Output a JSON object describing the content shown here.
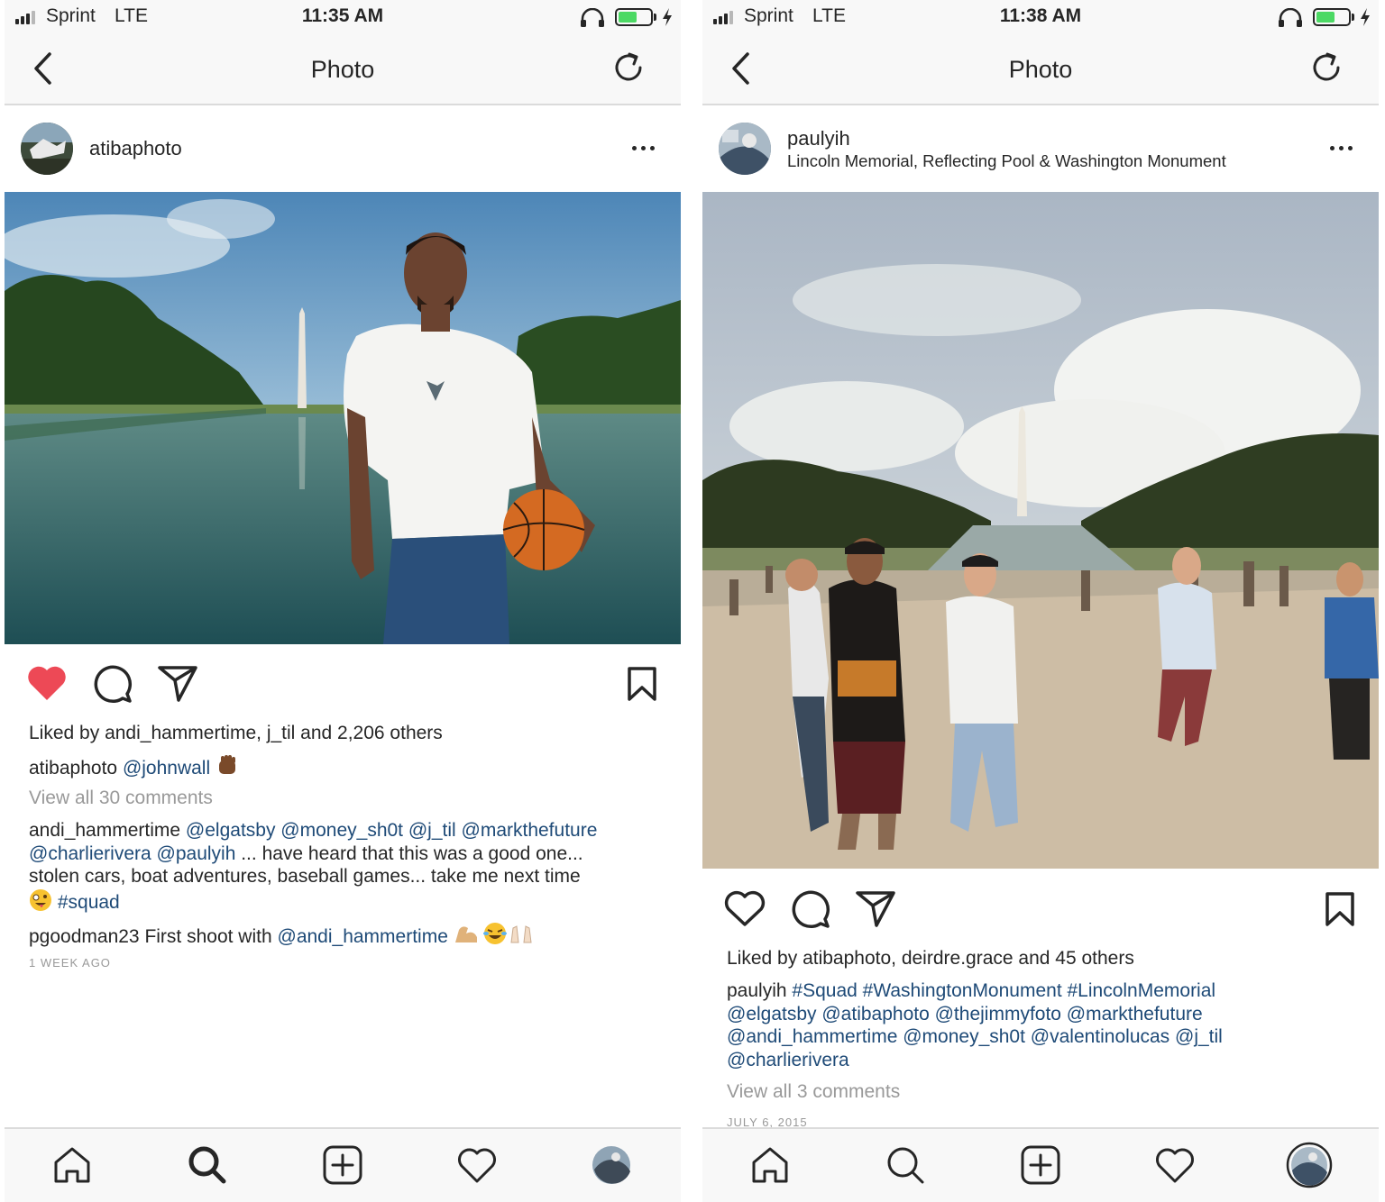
{
  "left": {
    "status": {
      "carrier": "Sprint",
      "network": "LTE",
      "time": "11:35 AM"
    },
    "nav": {
      "title": "Photo"
    },
    "post": {
      "username": "atibaphoto",
      "liked_prefix": "Liked by ",
      "liked_user1": "andi_hammertime",
      "liked_sep": ", ",
      "liked_user2": "j_til",
      "liked_and": " and ",
      "liked_count": "2,206 others",
      "caption_user": "atibaphoto",
      "caption_mention": "@johnwall",
      "view_comments": "View all 30 comments",
      "comment1": {
        "user": "andi_hammertime",
        "l1_mentions": "@elgatsby @money_sh0t @j_til @markthefuture",
        "l2_mentions": "@charlierivera @paulyih",
        "l2_text": " ... have heard that this was a good one...",
        "l3_text": "stolen cars, boat adventures, baseball games... take me next time",
        "l4_tag": "#squad"
      },
      "comment2": {
        "user": "pgoodman23",
        "text": " First shoot with ",
        "mention": "@andi_hammertime"
      },
      "timestamp": "1 WEEK AGO",
      "liked": true
    }
  },
  "right": {
    "status": {
      "carrier": "Sprint",
      "network": "LTE",
      "time": "11:38 AM"
    },
    "nav": {
      "title": "Photo"
    },
    "post": {
      "username": "paulyih",
      "location": "Lincoln Memorial, Reflecting Pool & Washington Monument",
      "liked_prefix": "Liked by ",
      "liked_user1": "atibaphoto",
      "liked_sep": ", ",
      "liked_user2": "deirdre.grace",
      "liked_and": " and ",
      "liked_count": "45 others",
      "caption_user": "paulyih",
      "caption_l1": "#Squad #WashingtonMonument #LincolnMemorial",
      "caption_l2": "@elgatsby @atibaphoto @thejimmyfoto @markthefuture",
      "caption_l3": "@andi_hammertime @money_sh0t @valentinolucas @j_til",
      "caption_l4": "@charlierivera",
      "view_comments": "View all 3 comments",
      "timestamp": "JULY 6, 2015",
      "liked": false
    }
  },
  "colors": {
    "like_red": "#ed4956",
    "link_blue": "#1e4a77",
    "muted_gray": "#999999",
    "battery_green": "#4cd964"
  },
  "icons": [
    "signal-icon",
    "headphones-icon",
    "battery-icon",
    "charging-icon",
    "back-chevron-icon",
    "refresh-icon",
    "more-icon",
    "heart-icon",
    "comment-icon",
    "share-icon",
    "bookmark-icon",
    "home-icon",
    "search-icon",
    "new-post-icon",
    "activity-icon",
    "profile-icon"
  ]
}
